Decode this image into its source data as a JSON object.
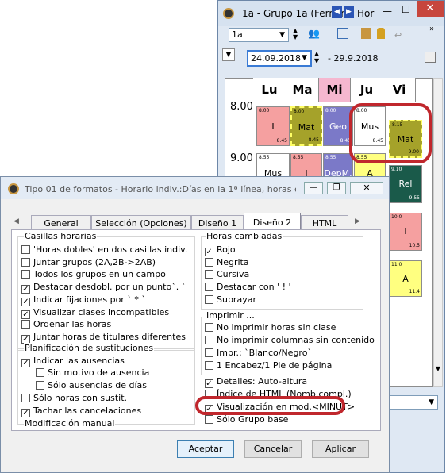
{
  "back_window": {
    "title": "1a - Grupo 1a (Fernán",
    "title_tail": "Hor",
    "class_value": "1a",
    "date_value": "24.09.2018",
    "date_end": "- 29.9.2018",
    "days": [
      "Lu",
      "Ma",
      "Mi",
      "Ju",
      "Vi"
    ],
    "times": [
      "8.00",
      "9.00"
    ],
    "lessons": [
      {
        "label": "I",
        "start": "8.00",
        "end": "8.45",
        "color": "#f5a0a0"
      },
      {
        "label": "Mat",
        "start": "8.00",
        "end": "8.45",
        "color": "#a5a22a"
      },
      {
        "label": "Geo",
        "start": "8.00",
        "end": "8.45",
        "color": "#7b79c8"
      },
      {
        "label": "Mus",
        "start": "8.00",
        "end": "8.45",
        "color": "#ffffff"
      },
      {
        "label": "Mat",
        "start": "8.15",
        "end": "9.00",
        "color": "#a5a22a"
      },
      {
        "label": "Mus",
        "start": "8.55",
        "end": "",
        "color": "#ffffff"
      },
      {
        "label": "I",
        "start": "8.55",
        "end": "",
        "color": "#f5a0a0"
      },
      {
        "label": "DepM.",
        "start": "8.55",
        "end": "",
        "color": "#7b79c8"
      },
      {
        "label": "A",
        "start": "8.55",
        "end": "",
        "color": "#ffff80"
      },
      {
        "label": "Rel",
        "start": "9.10",
        "end": "9.55",
        "color": "#1a5a4a"
      },
      {
        "label": "I",
        "start": "10.0",
        "end": "10.5",
        "color": "#f5a0a0"
      },
      {
        "label": "A",
        "start": "11.0",
        "end": "11.4",
        "color": "#ffff80"
      }
    ]
  },
  "dialog": {
    "title": "Tipo 01 de formatos - Horario indiv.:Días en la 1ª línea, horas e...",
    "tabs": [
      "General",
      "Selección (Opciones)",
      "Diseño 1",
      "Diseño 2",
      "HTML"
    ],
    "active_tab": "Diseño 2",
    "casillas": {
      "label": "Casillas horarias",
      "items": [
        {
          "label": "'Horas dobles' en dos casillas indiv.",
          "checked": false
        },
        {
          "label": "Juntar grupos (2A,2B->2AB)",
          "checked": false
        },
        {
          "label": "Todos los grupos en un campo",
          "checked": false
        },
        {
          "label": "Destacar desdobl. por un punto`. `",
          "checked": true
        },
        {
          "label": "Indicar fijaciones por ` * `",
          "checked": true
        },
        {
          "label": "Visualizar clases incompatibles",
          "checked": true
        },
        {
          "label": "Ordenar las horas",
          "checked": false
        },
        {
          "label": "Juntar horas de titulares diferentes",
          "checked": true
        }
      ]
    },
    "planificacion": {
      "label": "Planificación de sustituciones",
      "items": [
        {
          "label": "Indicar las ausencias",
          "checked": true
        },
        {
          "label": "Sin motivo de ausencia",
          "checked": false
        },
        {
          "label": "Sólo ausencias de días",
          "checked": false
        },
        {
          "label": "Sólo horas con sustit.",
          "checked": false
        },
        {
          "label": "Tachar las cancelaciones",
          "checked": true
        }
      ]
    },
    "modificacion_label": "Modificación manual",
    "horas_cambiadas": {
      "label": "Horas cambiadas",
      "items": [
        {
          "label": "Rojo",
          "checked": true
        },
        {
          "label": "Negrita",
          "checked": false
        },
        {
          "label": "Cursiva",
          "checked": false
        },
        {
          "label": "Destacar con ' ! '",
          "checked": false
        },
        {
          "label": "Subrayar",
          "checked": false
        }
      ]
    },
    "imprimir": {
      "label": "Imprimir ...",
      "items": [
        {
          "label": "No imprimir horas sin clase",
          "checked": false
        },
        {
          "label": "No imprimir columnas sin contenido",
          "checked": false
        },
        {
          "label": "Impr.: `Blanco/Negro`",
          "checked": false
        },
        {
          "label": "1 Encabez/1 Pie de página",
          "checked": false
        }
      ]
    },
    "extra": {
      "items": [
        {
          "label": "Detalles: Auto-altura",
          "checked": true
        },
        {
          "label": "Índice de HTML (Nomb.compl.)",
          "checked": false
        },
        {
          "label": "Visualización en mod.<MINUT>",
          "checked": true
        },
        {
          "label": "Sólo Grupo base",
          "checked": false
        }
      ]
    },
    "buttons": {
      "accept": "Aceptar",
      "cancel": "Cancelar",
      "apply": "Aplicar"
    }
  },
  "highlight_color": "#c0272d"
}
